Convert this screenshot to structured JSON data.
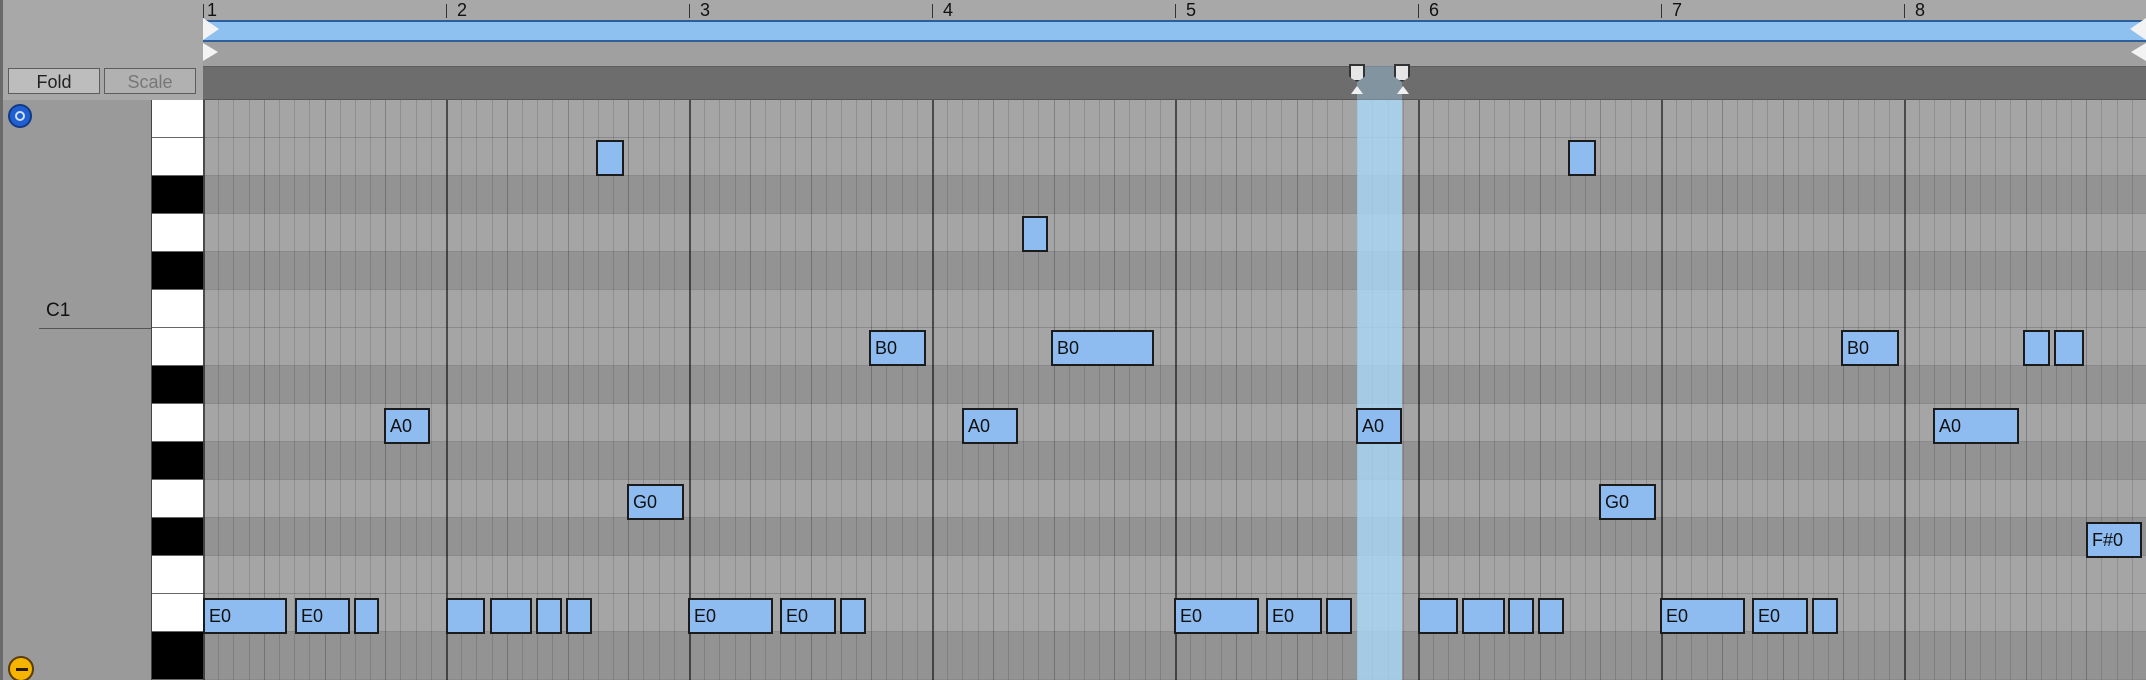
{
  "toolbar": {
    "fold_label": "Fold",
    "scale_label": "Scale"
  },
  "ruler": {
    "bars": [
      "1",
      "2",
      "3",
      "4",
      "5",
      "6",
      "7",
      "8"
    ]
  },
  "piano": {
    "c1_label": "C1"
  },
  "notes": [
    {
      "label": "E0"
    },
    {
      "label": "E0"
    },
    {
      "label": ""
    },
    {
      "label": ""
    },
    {
      "label": ""
    },
    {
      "label": ""
    },
    {
      "label": ""
    },
    {
      "label": "E0"
    },
    {
      "label": "E0"
    },
    {
      "label": ""
    },
    {
      "label": "E0"
    },
    {
      "label": "E0"
    },
    {
      "label": ""
    },
    {
      "label": ""
    },
    {
      "label": ""
    },
    {
      "label": ""
    },
    {
      "label": ""
    },
    {
      "label": "E0"
    },
    {
      "label": "E0"
    },
    {
      "label": ""
    },
    {
      "label": "A0"
    },
    {
      "label": "A0"
    },
    {
      "label": "A0"
    },
    {
      "label": "A0"
    },
    {
      "label": "G0"
    },
    {
      "label": "G0"
    },
    {
      "label": "B0"
    },
    {
      "label": "B0"
    },
    {
      "label": "B0"
    },
    {
      "label": "F#0"
    },
    {
      "label": ""
    },
    {
      "label": ""
    },
    {
      "label": ""
    },
    {
      "label": ""
    },
    {
      "label": ""
    }
  ],
  "icons": {
    "top_left": "hot-swap-icon",
    "bottom_left": "back-icon"
  },
  "colors": {
    "note_fill": "#8fbcf0",
    "loop_bar": "#8ec0f0",
    "selection": "#aadcff"
  }
}
